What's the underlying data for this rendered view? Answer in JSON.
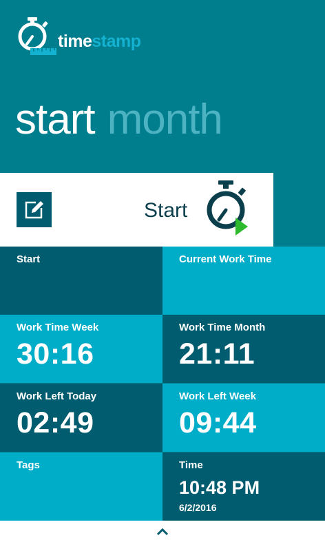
{
  "app": {
    "logo_word_1": "time",
    "logo_word_2": "stamp"
  },
  "pivot": {
    "items": [
      {
        "label": "start",
        "active": true
      },
      {
        "label": "month",
        "active": false
      }
    ]
  },
  "start_panel": {
    "button_label": "Start",
    "edit_icon": "edit-icon",
    "timer_icon": "stopwatch-play-icon"
  },
  "tiles": {
    "start": {
      "label": "Start",
      "value": ""
    },
    "current_work_time": {
      "label": "Current Work Time",
      "value": ""
    },
    "work_time_week": {
      "label": "Work Time Week",
      "value": "30:16"
    },
    "work_time_month": {
      "label": "Work Time Month",
      "value": "21:11"
    },
    "work_left_today": {
      "label": "Work Left Today",
      "value": "02:49"
    },
    "work_left_week": {
      "label": "Work Left Week",
      "value": "09:44"
    },
    "tags": {
      "label": "Tags",
      "value": ""
    },
    "time": {
      "label": "Time",
      "value": "10:48 PM",
      "date": "6/2/2016"
    }
  },
  "app_bar": {
    "expand_icon": "chevron-up-icon"
  },
  "colors": {
    "background": "#007e8e",
    "tile_dark": "#005c6e",
    "tile_light": "#00adc8",
    "accent_blue": "#15b1d0",
    "play_green": "#2dbb2d",
    "white": "#ffffff"
  }
}
